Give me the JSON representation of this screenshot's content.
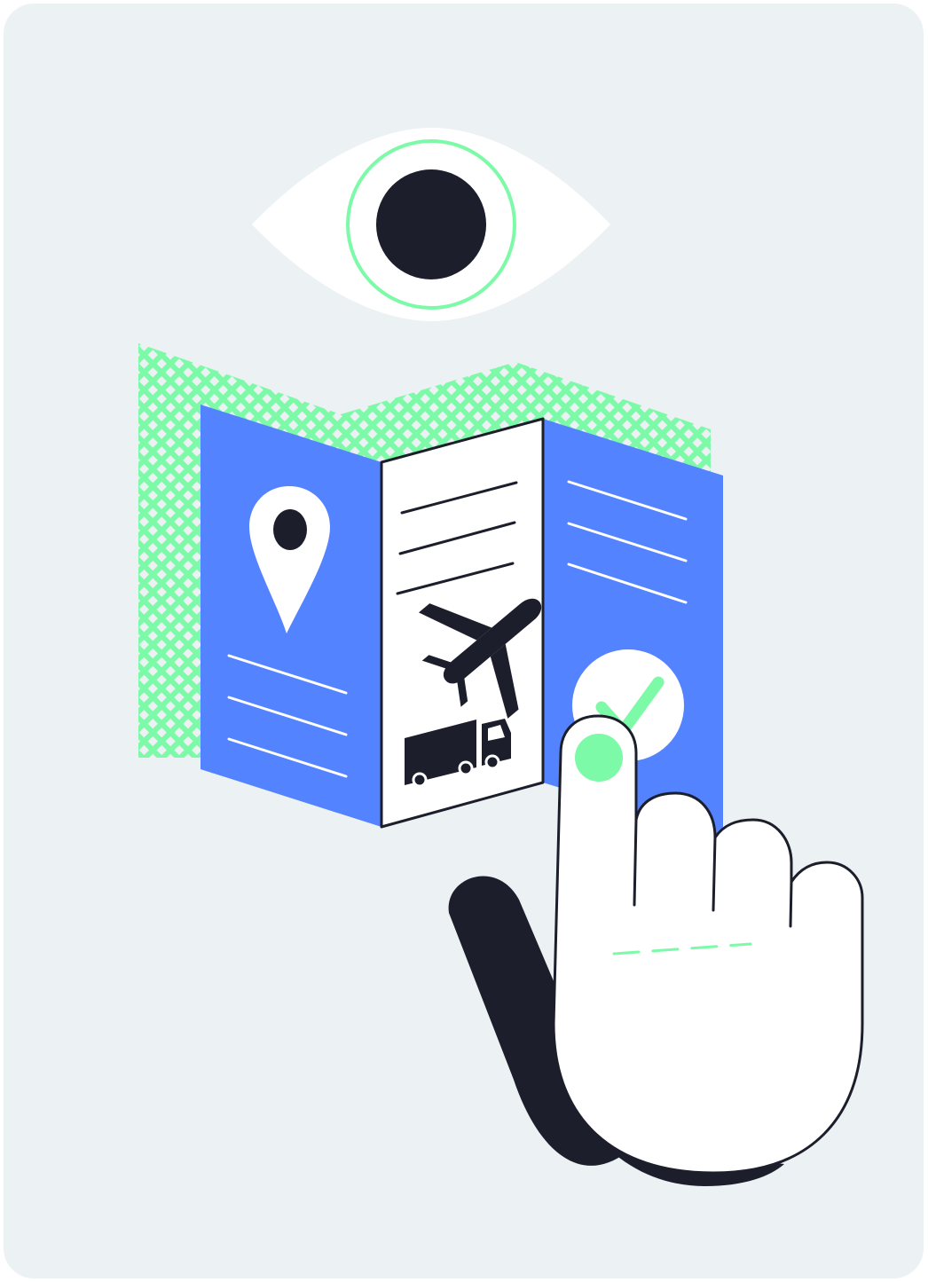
{
  "illustration": {
    "colors": {
      "background": "#ECF1F4",
      "ink": "#1C1F2B",
      "white": "#FFFFFF",
      "blue": "#5383FF",
      "green": "#7DFAA8"
    },
    "icons": [
      "eye-icon",
      "map-icon",
      "location-pin-icon",
      "airplane-icon",
      "truck-icon",
      "check-circle-icon",
      "pointing-hand-icon"
    ]
  }
}
